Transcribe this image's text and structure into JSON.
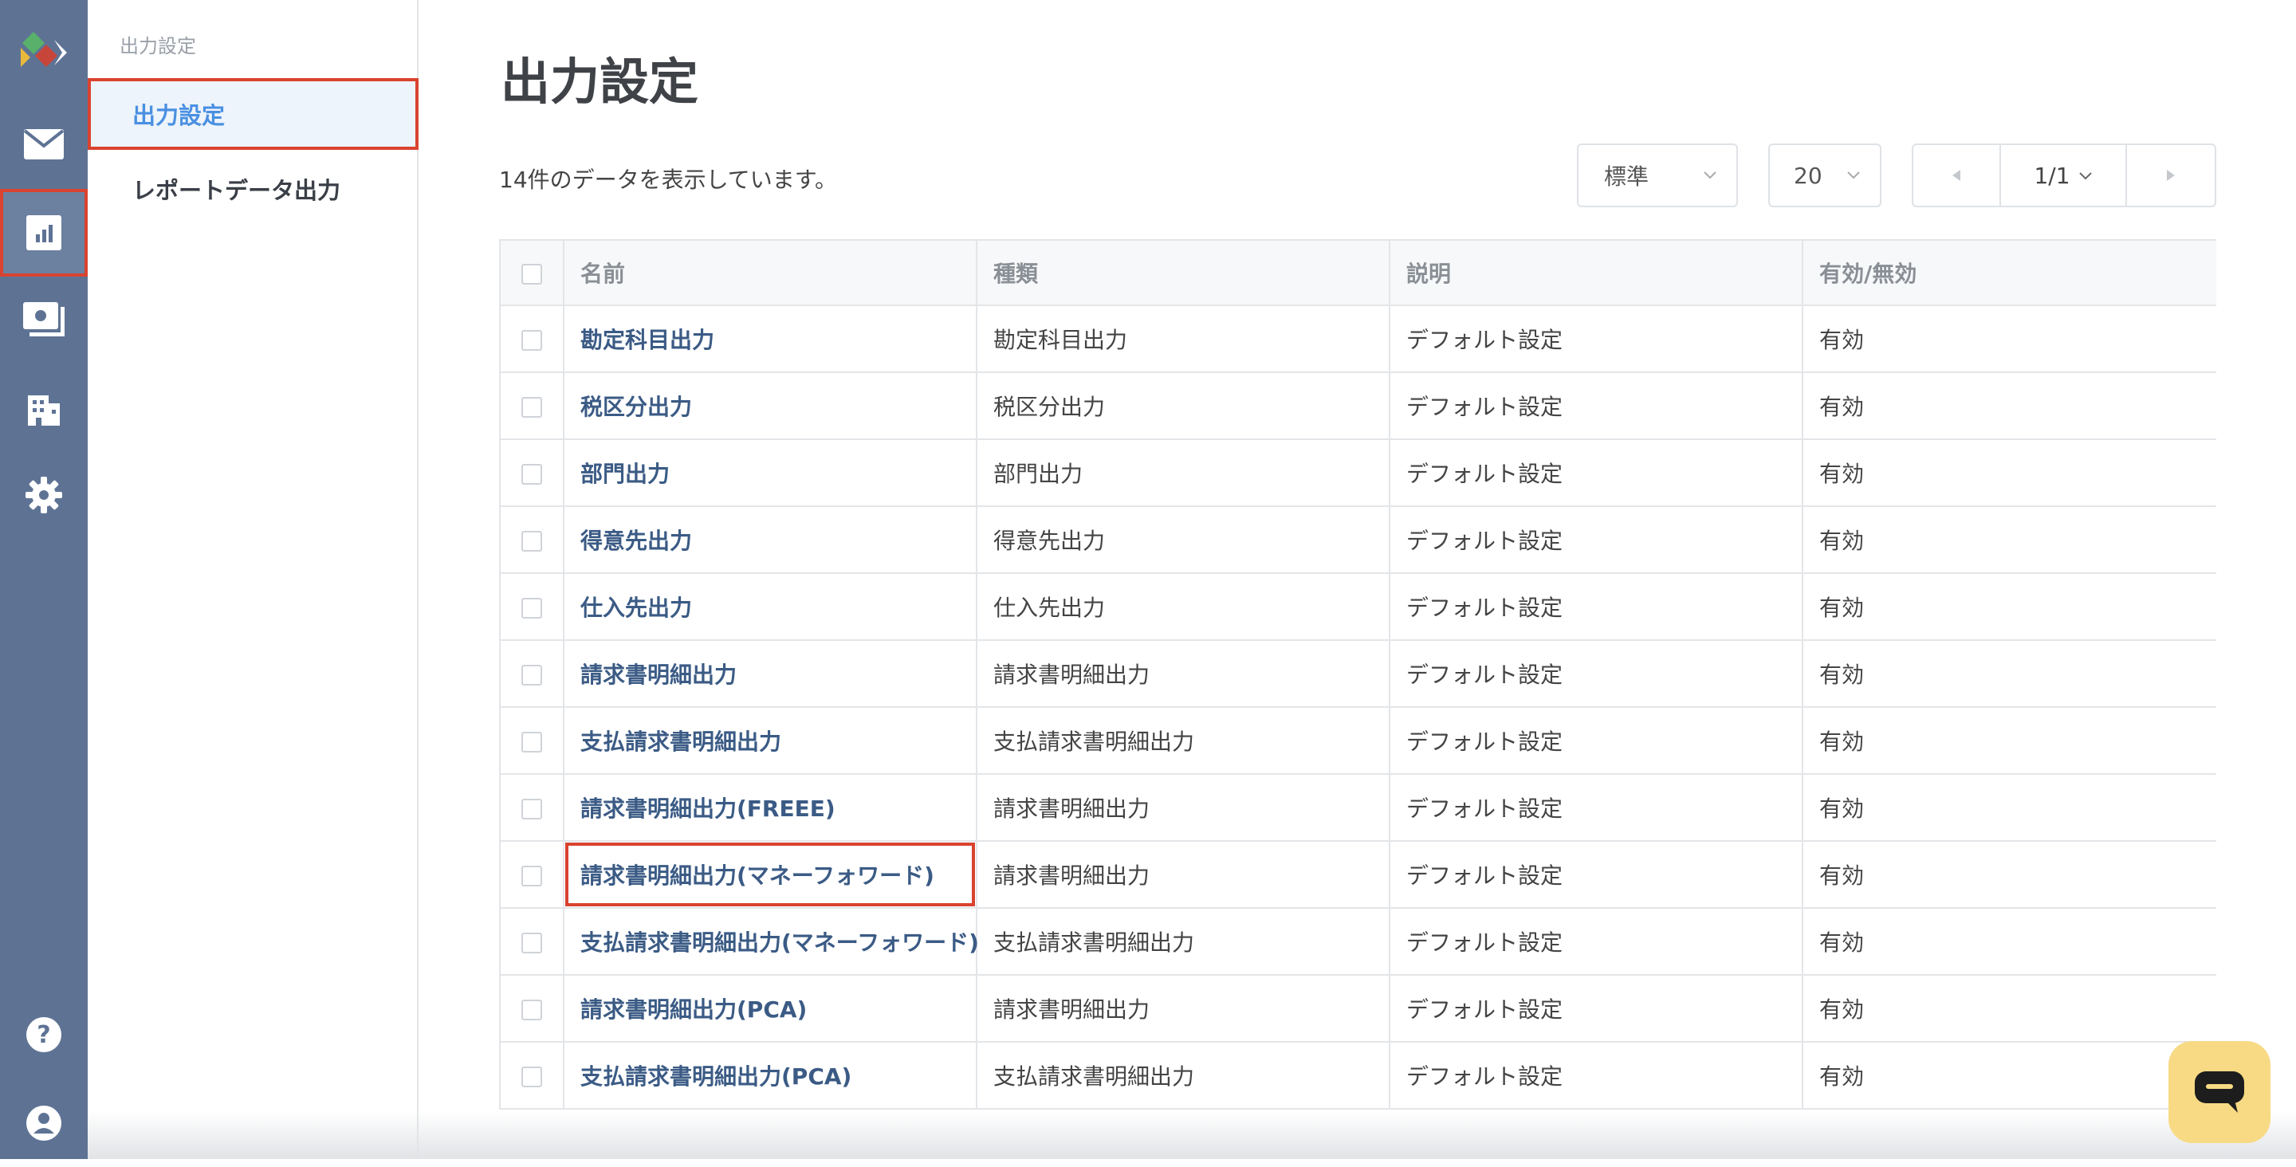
{
  "app": {
    "brand_colors": {
      "rail": "#5e7394",
      "accent": "#4a90e2",
      "highlight": "#d9432f",
      "chat": "#f8da85"
    }
  },
  "rail": {
    "icons": [
      "logo-icon",
      "mail-icon",
      "report-chart-icon",
      "invoice-icon",
      "building-icon",
      "gear-icon",
      "help-icon",
      "user-icon"
    ]
  },
  "subnav": {
    "heading": "出力設定",
    "items": [
      {
        "label": "出力設定",
        "active": true
      },
      {
        "label": "レポートデータ出力",
        "active": false
      }
    ]
  },
  "main": {
    "title": "出力設定",
    "count_text": "14件のデータを表示しています。",
    "view_select": "標準",
    "per_page_select": "20",
    "pager": {
      "page": "1/1"
    }
  },
  "table": {
    "headers": [
      "名前",
      "種類",
      "説明",
      "有効/無効"
    ],
    "rows": [
      {
        "name": "勘定科目出力",
        "type": "勘定科目出力",
        "desc": "デフォルト設定",
        "status": "有効"
      },
      {
        "name": "税区分出力",
        "type": "税区分出力",
        "desc": "デフォルト設定",
        "status": "有効"
      },
      {
        "name": "部門出力",
        "type": "部門出力",
        "desc": "デフォルト設定",
        "status": "有効"
      },
      {
        "name": "得意先出力",
        "type": "得意先出力",
        "desc": "デフォルト設定",
        "status": "有効"
      },
      {
        "name": "仕入先出力",
        "type": "仕入先出力",
        "desc": "デフォルト設定",
        "status": "有効"
      },
      {
        "name": "請求書明細出力",
        "type": "請求書明細出力",
        "desc": "デフォルト設定",
        "status": "有効"
      },
      {
        "name": "支払請求書明細出力",
        "type": "支払請求書明細出力",
        "desc": "デフォルト設定",
        "status": "有効"
      },
      {
        "name": "請求書明細出力(FREEE)",
        "type": "請求書明細出力",
        "desc": "デフォルト設定",
        "status": "有効"
      },
      {
        "name": "請求書明細出力(マネーフォワード)",
        "type": "請求書明細出力",
        "desc": "デフォルト設定",
        "status": "有効"
      },
      {
        "name": "支払請求書明細出力(マネーフォワード)",
        "type": "支払請求書明細出力",
        "desc": "デフォルト設定",
        "status": "有効"
      },
      {
        "name": "請求書明細出力(PCA)",
        "type": "請求書明細出力",
        "desc": "デフォルト設定",
        "status": "有効"
      },
      {
        "name": "支払請求書明細出力(PCA)",
        "type": "支払請求書明細出力",
        "desc": "デフォルト設定",
        "status": "有効"
      }
    ]
  }
}
